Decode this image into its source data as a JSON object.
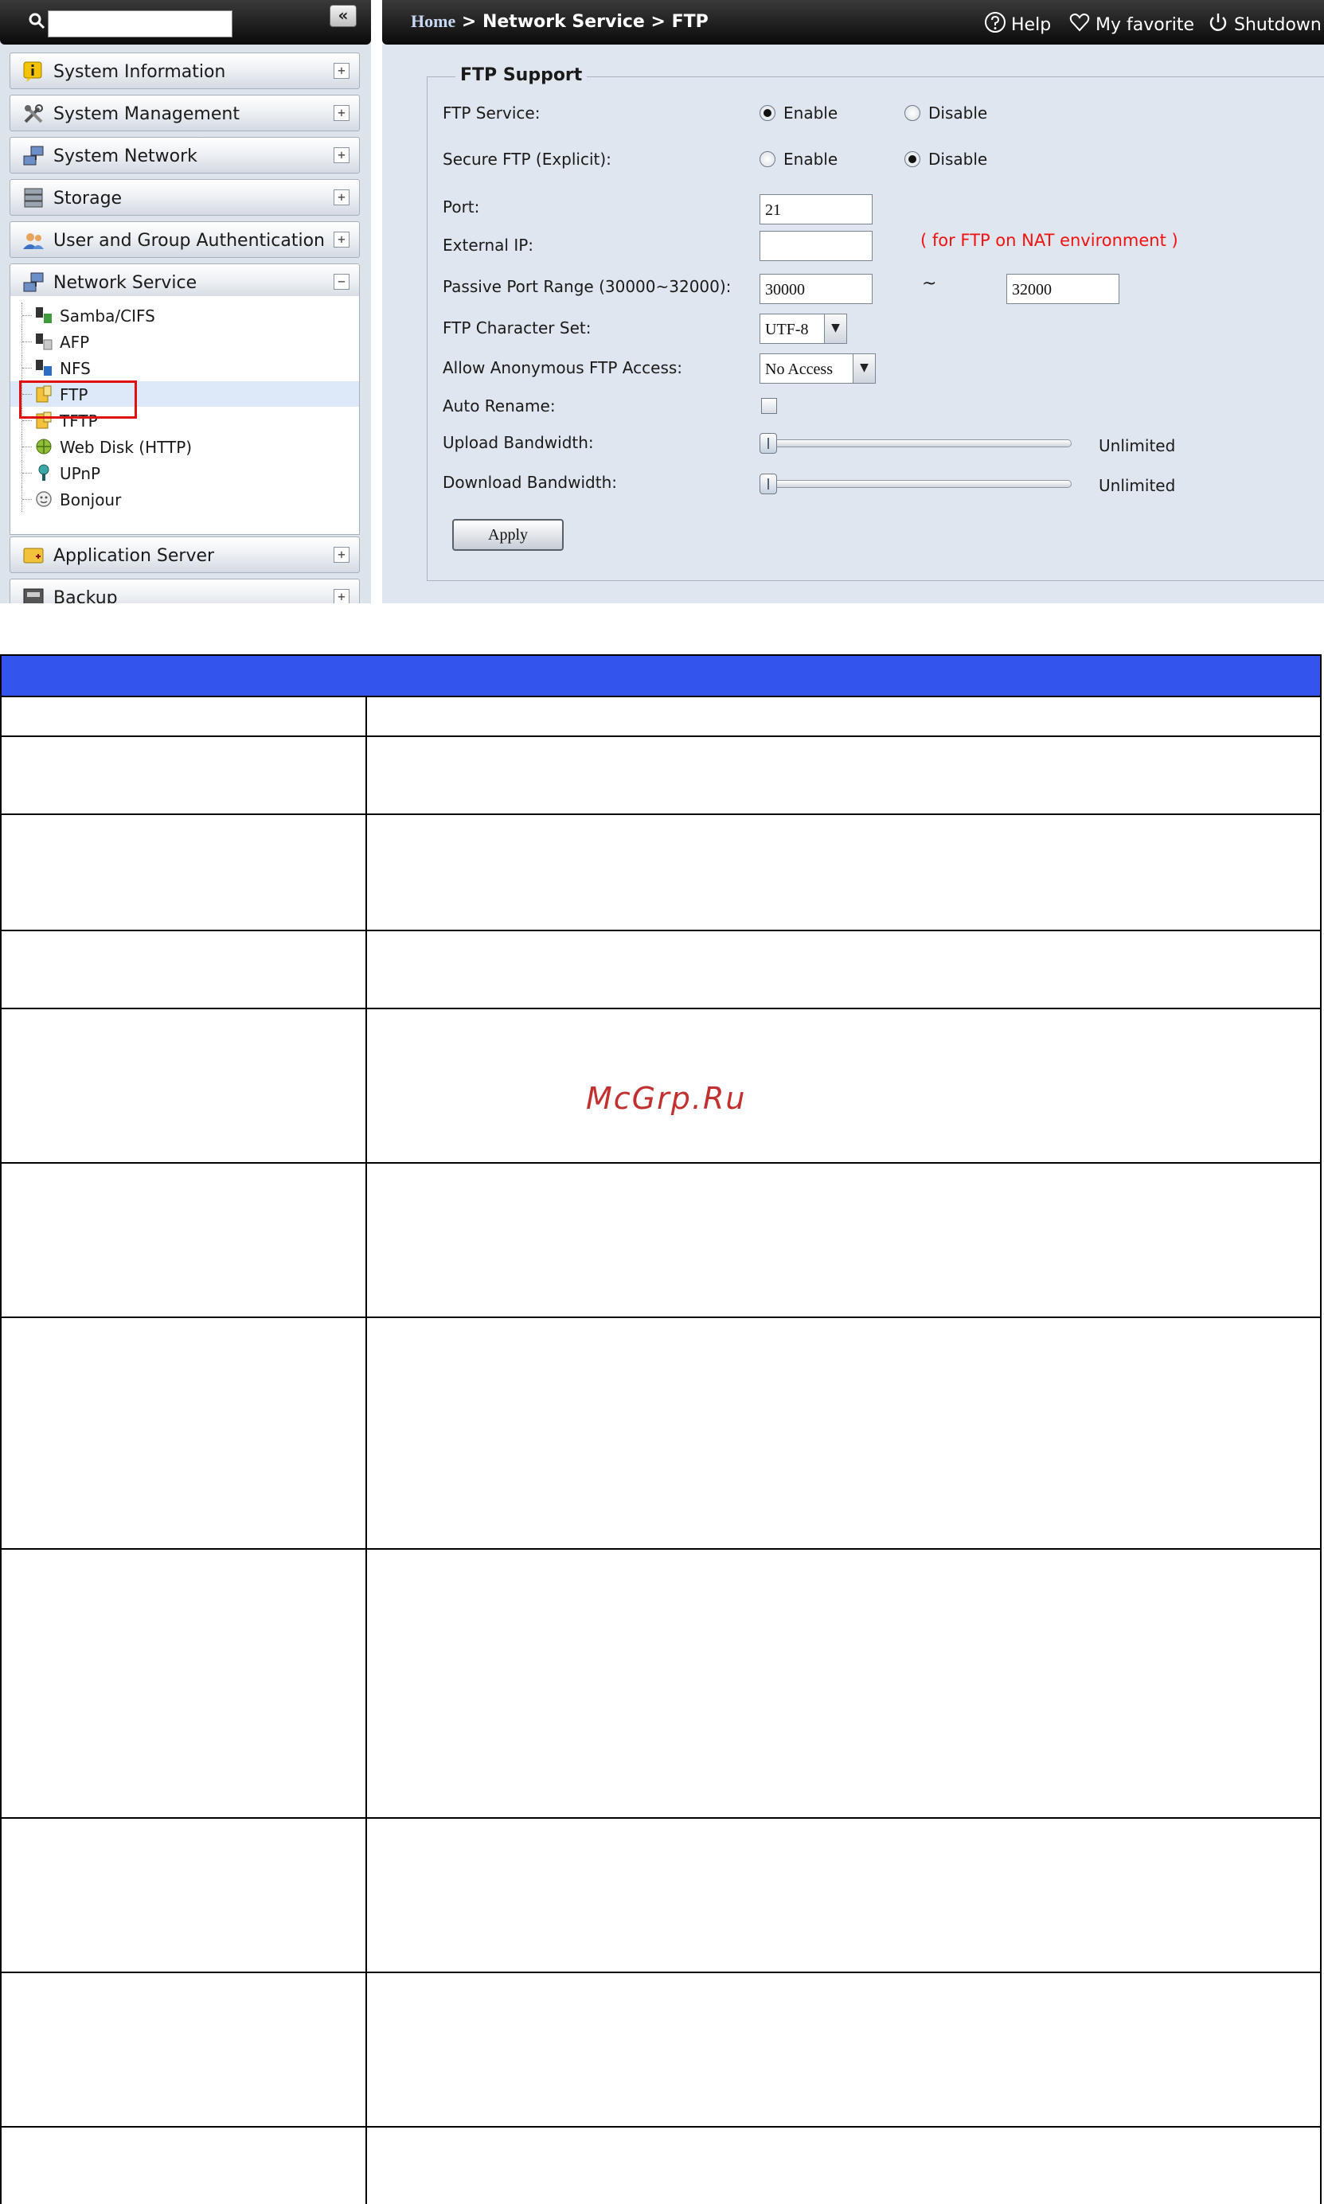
{
  "sidebar": {
    "search": {
      "value": "",
      "placeholder": ""
    },
    "collapse_label": "«",
    "categories": [
      {
        "label": "System Information",
        "icon": "info-icon",
        "toggle": "+"
      },
      {
        "label": "System Management",
        "icon": "tools-icon",
        "toggle": "+"
      },
      {
        "label": "System Network",
        "icon": "network-icon",
        "toggle": "+"
      },
      {
        "label": "Storage",
        "icon": "storage-icon",
        "toggle": "+"
      },
      {
        "label": "User and Group Authentication",
        "icon": "users-icon",
        "toggle": "+"
      },
      {
        "label": "Network Service",
        "icon": "network-service-icon",
        "toggle": "−"
      },
      {
        "label": "Application Server",
        "icon": "app-server-icon",
        "toggle": "+"
      },
      {
        "label": "Backup",
        "icon": "backup-icon",
        "toggle": "+"
      }
    ],
    "network_service_items": [
      {
        "label": "Samba/CIFS",
        "icon": "samba-icon"
      },
      {
        "label": "AFP",
        "icon": "afp-icon"
      },
      {
        "label": "NFS",
        "icon": "nfs-icon"
      },
      {
        "label": "FTP",
        "icon": "ftp-icon",
        "selected": true
      },
      {
        "label": "TFTP",
        "icon": "tftp-icon"
      },
      {
        "label": "Web Disk (HTTP)",
        "icon": "web-disk-icon"
      },
      {
        "label": "UPnP",
        "icon": "upnp-icon"
      },
      {
        "label": "Bonjour",
        "icon": "bonjour-icon"
      }
    ]
  },
  "header": {
    "breadcrumb": {
      "home": "Home",
      "sep1": " > ",
      "section": "Network Service",
      "sep2": " > ",
      "page": "FTP"
    },
    "help": "Help",
    "favorite": "My favorite",
    "shutdown": "Shutdown"
  },
  "ftp": {
    "legend": "FTP Support",
    "service": {
      "label": "FTP Service:",
      "enable": "Enable",
      "disable": "Disable",
      "selected": "Enable"
    },
    "secure": {
      "label": "Secure FTP (Explicit):",
      "enable": "Enable",
      "disable": "Disable",
      "selected": "Disable"
    },
    "port": {
      "label": "Port:",
      "value": "21"
    },
    "external_ip": {
      "label": "External IP:",
      "value": "",
      "note": "( for FTP on NAT environment )"
    },
    "passive": {
      "label": "Passive Port Range (30000~32000):",
      "from": "30000",
      "tilde": "~",
      "to": "32000"
    },
    "charset": {
      "label": "FTP Character Set:",
      "value": "UTF-8"
    },
    "anonymous": {
      "label": "Allow Anonymous FTP Access:",
      "value": "No Access"
    },
    "auto_rename": {
      "label": "Auto Rename:",
      "checked": false
    },
    "upload": {
      "label": "Upload Bandwidth:",
      "value": "Unlimited"
    },
    "download": {
      "label": "Download Bandwidth:",
      "value": "Unlimited"
    },
    "apply": "Apply"
  },
  "watermark": "McGrp.Ru",
  "colors": {
    "table_header": "#3355ee",
    "nat_note": "#f21010",
    "selection_box": "#e01010"
  }
}
